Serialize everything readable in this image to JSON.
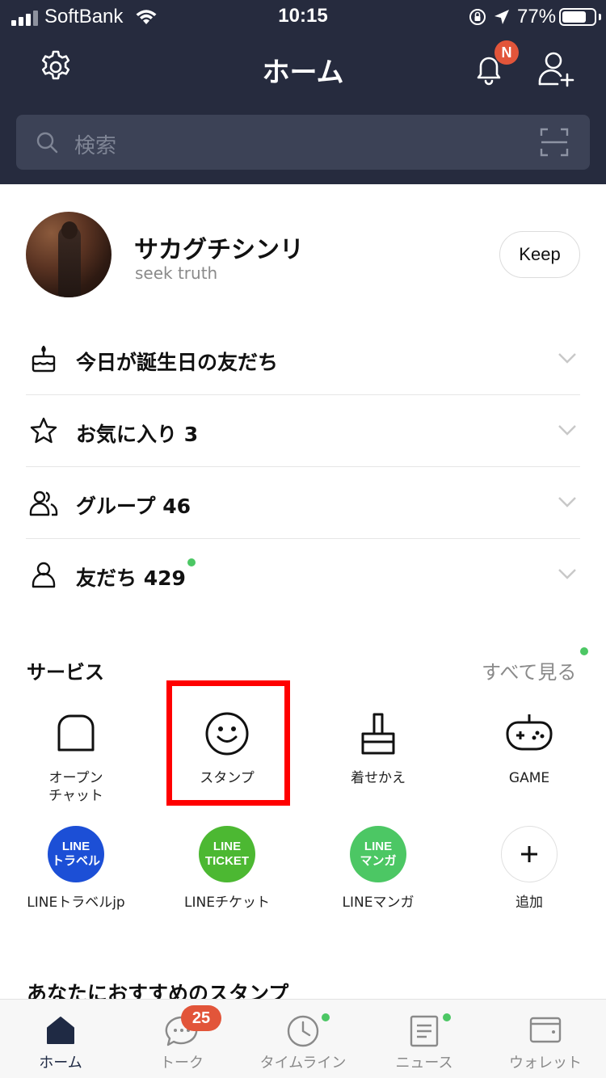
{
  "status_bar": {
    "carrier": "SoftBank",
    "time": "10:15",
    "battery_percent": "77%",
    "battery_level": 0.77
  },
  "header": {
    "title": "ホーム",
    "notification_badge": "N",
    "search_placeholder": "検索"
  },
  "profile": {
    "name": "サカグチシンリ",
    "status_message": "seek truth",
    "keep_label": "Keep"
  },
  "lists": [
    {
      "label": "今日が誕生日の友だち",
      "icon": "birthday-cake-icon"
    },
    {
      "label": "お気に入り 3",
      "icon": "star-icon"
    },
    {
      "label": "グループ 46",
      "icon": "group-icon"
    },
    {
      "label": "友だち 429",
      "icon": "person-icon"
    }
  ],
  "services": {
    "title": "サービス",
    "see_all": "すべて見る",
    "items": [
      {
        "label": "オープン\nチャット",
        "icon": "open-chat-icon"
      },
      {
        "label": "スタンプ",
        "icon": "smiley-icon"
      },
      {
        "label": "着せかえ",
        "icon": "brush-icon"
      },
      {
        "label": "GAME",
        "icon": "gamepad-icon"
      },
      {
        "label": "LINEトラベルjp",
        "icon_text": "LINE\nトラベル",
        "color": "#1c4fd6"
      },
      {
        "label": "LINEチケット",
        "icon_text": "LINE\nTICKET",
        "color": "#4cb832"
      },
      {
        "label": "LINEマンガ",
        "icon_text": "LINE\nマンガ",
        "color": "#4cc764"
      },
      {
        "label": "追加",
        "icon": "plus-icon"
      }
    ]
  },
  "recommend_title": "あなたにおすすめのスタンプ",
  "tabs": [
    {
      "label": "ホーム",
      "icon": "home-icon"
    },
    {
      "label": "トーク",
      "icon": "chat-icon"
    },
    {
      "label": "タイムライン",
      "icon": "clock-icon"
    },
    {
      "label": "ニュース",
      "icon": "news-icon"
    },
    {
      "label": "ウォレット",
      "icon": "wallet-icon"
    }
  ],
  "talk_badge": "25",
  "colors": {
    "header_bg": "#262b3e",
    "accent_green": "#4cc764",
    "badge_red": "#e2553a",
    "highlight": "#ff0000"
  }
}
